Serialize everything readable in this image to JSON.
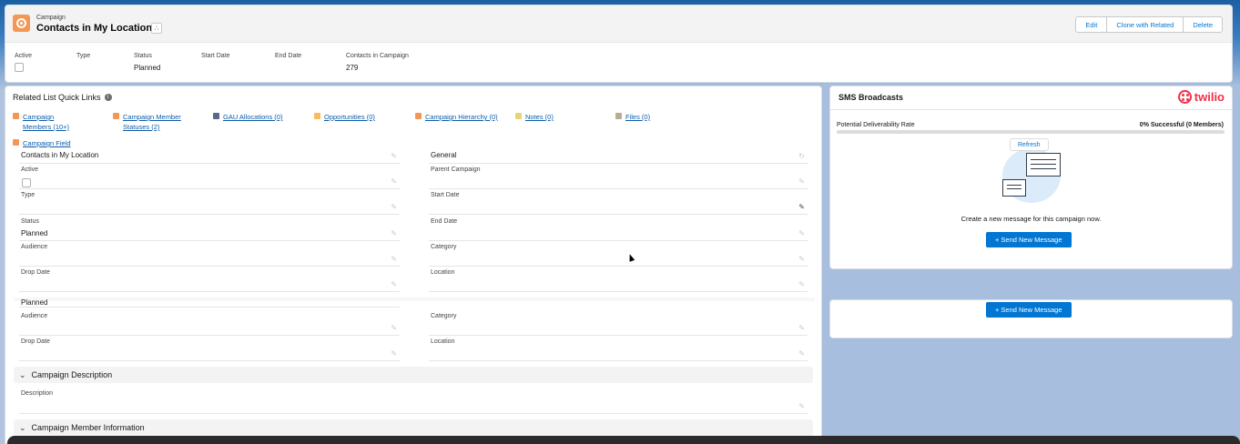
{
  "header": {
    "object_label": "Campaign",
    "title": "Contacts in My Location",
    "buttons": [
      "Edit",
      "Clone with Related",
      "Delete"
    ],
    "highlights": [
      {
        "label": "Active",
        "value": "",
        "checkbox": true
      },
      {
        "label": "Type",
        "value": ""
      },
      {
        "label": "Status",
        "value": "Planned"
      },
      {
        "label": "Start Date",
        "value": ""
      },
      {
        "label": "End Date",
        "value": ""
      },
      {
        "label": "Contacts in Campaign",
        "value": "279"
      }
    ]
  },
  "related": {
    "title": "Related List Quick Links",
    "links": [
      {
        "label": "Campaign Members (10+)",
        "line1": "Campaign",
        "line2": "Members (10+)",
        "color": "#f49756"
      },
      {
        "label": "Campaign Member Statuses (2)",
        "line1": "Campaign Member",
        "line2": "Statuses (2)",
        "color": "#f49756"
      },
      {
        "label": "GAU Allocations (0)",
        "color": "#54698d"
      },
      {
        "label": "Opportunities (0)",
        "color": "#fcb95b"
      },
      {
        "label": "Campaign Hierarchy (0)",
        "color": "#f49756"
      },
      {
        "label": "Notes (0)",
        "color": "#e6d478"
      },
      {
        "label": "Files (0)",
        "color": "#baac93"
      },
      {
        "label": "Campaign Field",
        "color": "#f49756"
      }
    ]
  },
  "details": {
    "name_value": "Contacts in My Location",
    "record_type_value": "General",
    "left": [
      {
        "label": "Active",
        "value": ""
      },
      {
        "label": "Type",
        "value": ""
      },
      {
        "label": "Status",
        "value": "Planned"
      },
      {
        "label": "Audience",
        "value": ""
      },
      {
        "label": "Drop Date",
        "value": ""
      }
    ],
    "right": [
      {
        "label": "Parent Campaign",
        "value": ""
      },
      {
        "label": "Start Date",
        "value": ""
      },
      {
        "label": "End Date",
        "value": ""
      },
      {
        "label": "Category",
        "value": ""
      },
      {
        "label": "Location",
        "value": ""
      }
    ],
    "dup_status_value": "Planned",
    "dup_left": [
      {
        "label": "Audience",
        "value": ""
      },
      {
        "label": "Drop Date",
        "value": ""
      }
    ],
    "dup_right": [
      {
        "label": "Category",
        "value": ""
      },
      {
        "label": "Location",
        "value": ""
      }
    ]
  },
  "sections": {
    "description_title": "Campaign Description",
    "description_label": "Description",
    "member_info_title": "Campaign Member Information"
  },
  "sms": {
    "title": "SMS Broadcasts",
    "brand": "twilio",
    "deliverability_label": "Potential Deliverability Rate",
    "deliverability_value": "0% Successful (0 Members)",
    "refresh_label": "Refresh",
    "create_text": "Create a new message for this campaign now.",
    "send_label": "Send New Message"
  }
}
